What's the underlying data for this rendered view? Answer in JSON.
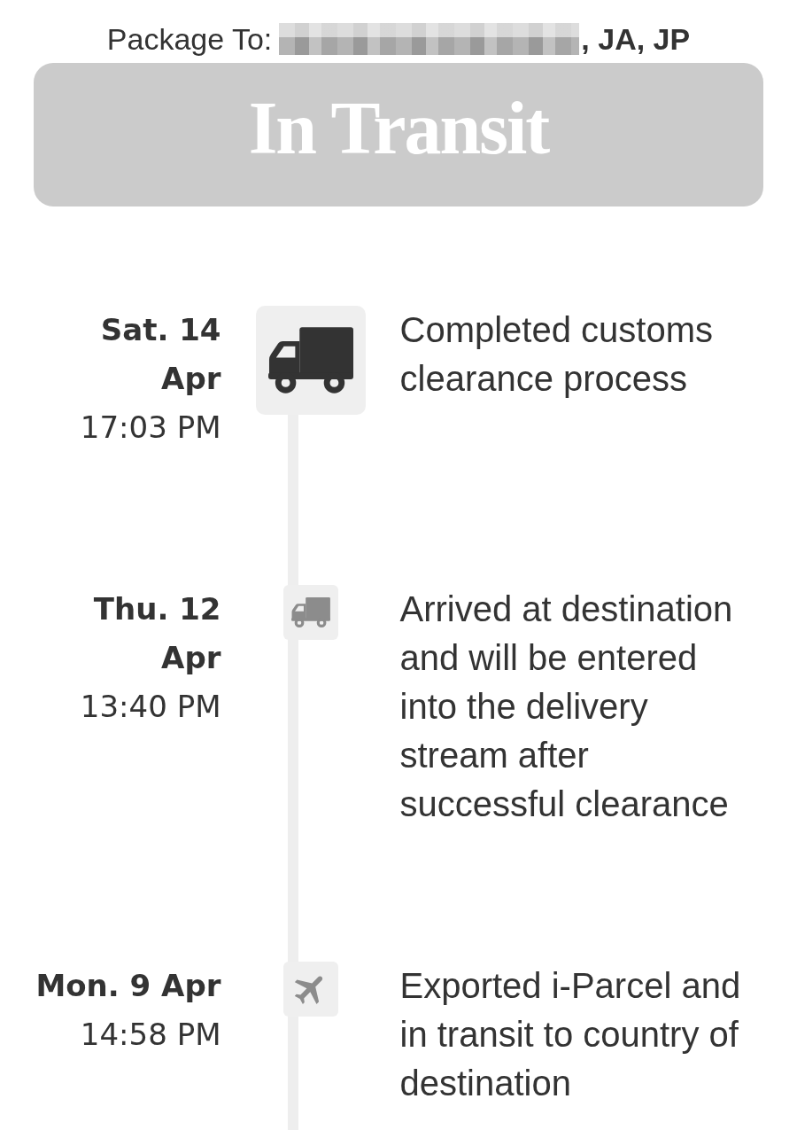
{
  "header": {
    "label": "Package To:",
    "recipient_redacted": true,
    "recipient_suffix": ", JA, JP"
  },
  "status": {
    "title": "In Transit"
  },
  "events": [
    {
      "date": "Sat. 14 Apr",
      "time": "17:03 PM",
      "kind": "truck",
      "current": true,
      "description": "Completed customs clearance process"
    },
    {
      "date": "Thu. 12 Apr",
      "time": "13:40 PM",
      "kind": "truck",
      "current": false,
      "description": "Arrived at destination and will be entered into the delivery stream after successful clearance"
    },
    {
      "date": "Mon. 9 Apr",
      "time": "14:58 PM",
      "kind": "plane",
      "current": false,
      "description": "Exported i-Parcel and in transit to country of destination"
    }
  ]
}
